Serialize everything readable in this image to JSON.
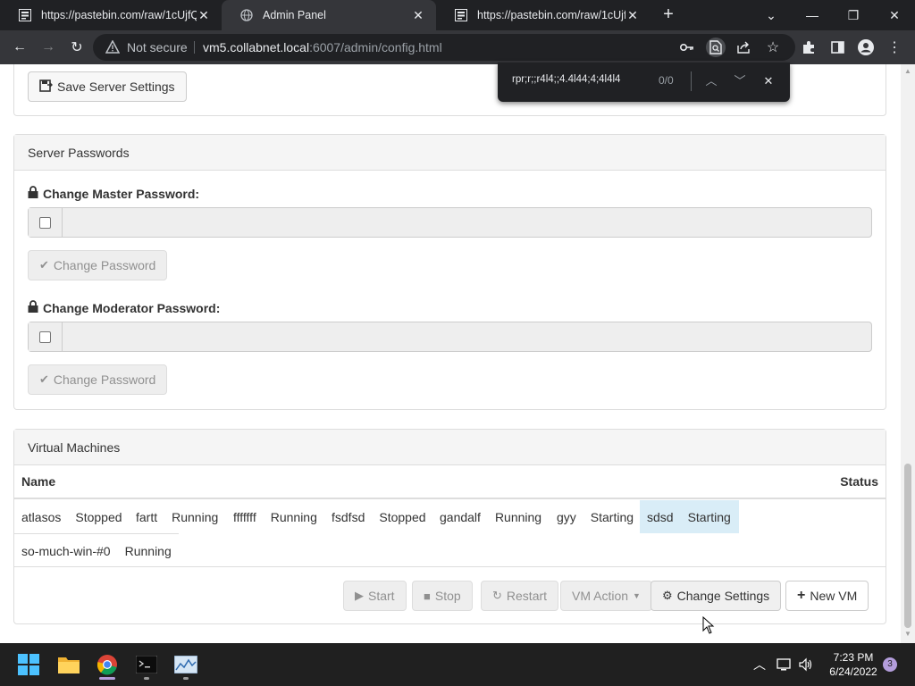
{
  "browser": {
    "tabs": [
      {
        "title": "https://pastebin.com/raw/1cUjfQ"
      },
      {
        "title": "Admin Panel"
      },
      {
        "title": "https://pastebin.com/raw/1cUjfQ"
      }
    ],
    "security_label": "Not secure",
    "url_host": "vm5.collabnet.local",
    "url_rest": ":6007/admin/config.html"
  },
  "find": {
    "query": "rpr;r;;r4l4;;4.4l44;4;4l4l4",
    "count": "0/0"
  },
  "server_settings": {
    "save_label": "Save Server Settings"
  },
  "passwords": {
    "heading": "Server Passwords",
    "master_label": "Change Master Password:",
    "moderator_label": "Change Moderator Password:",
    "change_label": "Change Password"
  },
  "vms": {
    "heading": "Virtual Machines",
    "col_name": "Name",
    "col_status": "Status",
    "rows": [
      {
        "name": "atlasos",
        "status": "Stopped"
      },
      {
        "name": "fartt",
        "status": "Running"
      },
      {
        "name": "fffffff",
        "status": "Running"
      },
      {
        "name": "fsdfsd",
        "status": "Stopped"
      },
      {
        "name": "gandalf",
        "status": "Running"
      },
      {
        "name": "gyy",
        "status": "Starting"
      },
      {
        "name": "sdsd",
        "status": "Starting"
      },
      {
        "name": "so-much-win-#0",
        "status": "Running"
      }
    ],
    "actions": {
      "start": "Start",
      "stop": "Stop",
      "restart": "Restart",
      "vm_action": "VM Action",
      "change_settings": "Change Settings",
      "new_vm": "New VM"
    }
  },
  "taskbar": {
    "time": "7:23 PM",
    "date": "6/24/2022",
    "notification_count": "3"
  }
}
